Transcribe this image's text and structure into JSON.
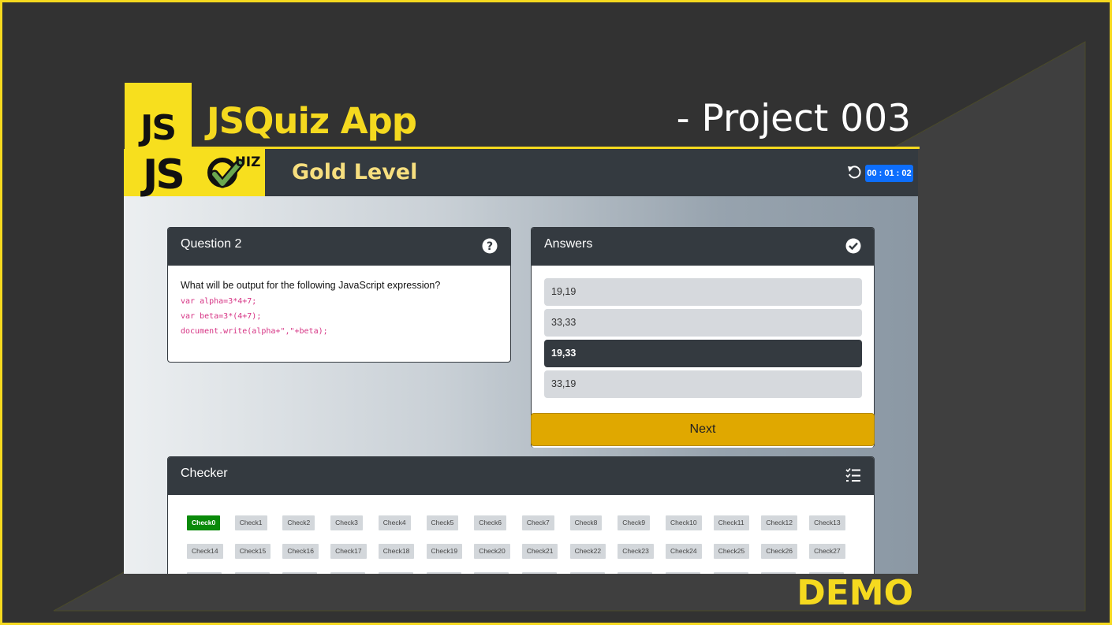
{
  "banner": {
    "badge": "JS",
    "app_title": "JSQuiz App",
    "project": "- Project 003",
    "demo": "DEMO"
  },
  "colors": {
    "accent_yellow": "#f5d91f",
    "dark_panel": "#343a40",
    "timer_blue": "#0d6efd",
    "next_button": "#e0a800",
    "active_check": "#0a8a0a"
  },
  "app": {
    "logo_js": "JS",
    "logo_quiz": "UIZ",
    "level": "Gold Level",
    "reset_icon": "undo-icon",
    "timer": "00 : 01 : 02"
  },
  "question": {
    "heading": "Question 2",
    "icon": "question-circle-icon",
    "text": "What will be output for the following JavaScript expression?",
    "code": [
      "var alpha=3*4+7;",
      "var beta=3*(4+7);",
      "document.write(alpha+\",\"+beta);"
    ]
  },
  "answers": {
    "heading": "Answers",
    "icon": "check-circle-icon",
    "options": [
      "19,19",
      "33,33",
      "19,33",
      "33,19"
    ],
    "selected_index": 2,
    "next_label": "Next"
  },
  "checker": {
    "heading": "Checker",
    "icon": "checklist-icon",
    "active_index": 0,
    "items": [
      "Check0",
      "Check1",
      "Check2",
      "Check3",
      "Check4",
      "Check5",
      "Check6",
      "Check7",
      "Check8",
      "Check9",
      "Check10",
      "Check11",
      "Check12",
      "Check13",
      "Check14",
      "Check15",
      "Check16",
      "Check17",
      "Check18",
      "Check19",
      "Check20",
      "Check21",
      "Check22",
      "Check23",
      "Check24",
      "Check25",
      "Check26",
      "Check27",
      "",
      "",
      "",
      "",
      "",
      "",
      "",
      "",
      "",
      "",
      "",
      "",
      "",
      ""
    ]
  }
}
